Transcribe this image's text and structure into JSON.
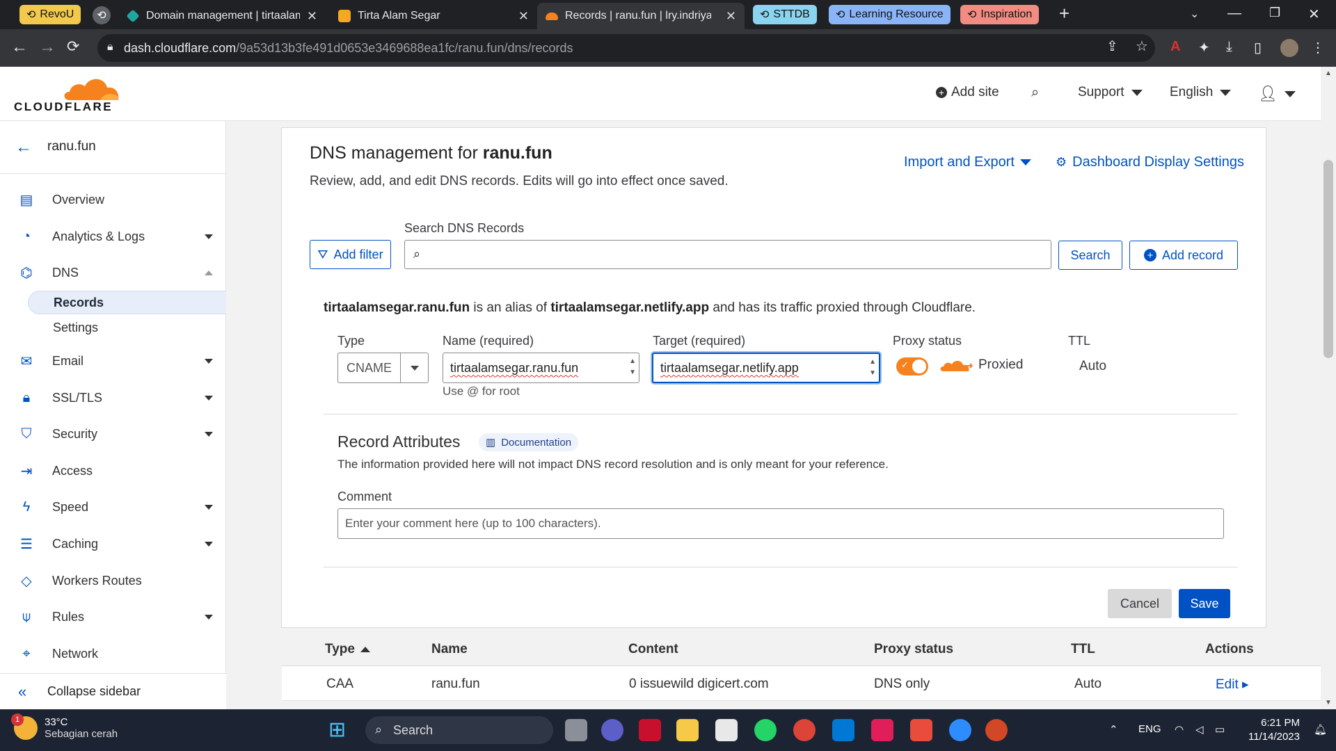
{
  "browser": {
    "tab_groups": [
      {
        "label": "RevoU",
        "color": "#f2c94c"
      },
      {
        "label": "STTDB",
        "color": "#8ad4f0"
      },
      {
        "label": "Learning Resource",
        "color": "#8ab4f8"
      },
      {
        "label": "Inspiration",
        "color": "#f28b82"
      }
    ],
    "tabs": [
      {
        "title": "Domain management | tirtaalam",
        "close": "✕"
      },
      {
        "title": "Tirta Alam Segar",
        "close": "✕"
      },
      {
        "title": "Records | ranu.fun | lry.indriyanto",
        "close": "✕"
      }
    ],
    "new_tab": "+",
    "url_host": "dash.cloudflare.com",
    "url_path": "/9a53d13b3fe491d0653e3469688ea1fc/ranu.fun/dns/records"
  },
  "header": {
    "logo_text": "CLOUDFLARE",
    "add_site": "Add site",
    "support": "Support",
    "language": "English"
  },
  "sidebar": {
    "zone": "ranu.fun",
    "items": [
      {
        "label": "Overview",
        "icon": "clipboard-icon"
      },
      {
        "label": "Analytics & Logs",
        "icon": "pie-chart-icon"
      },
      {
        "label": "DNS",
        "icon": "network-icon"
      },
      {
        "label": "Email",
        "icon": "envelope-icon"
      },
      {
        "label": "SSL/TLS",
        "icon": "lock-icon"
      },
      {
        "label": "Security",
        "icon": "shield-icon"
      },
      {
        "label": "Access",
        "icon": "access-icon"
      },
      {
        "label": "Speed",
        "icon": "bolt-icon"
      },
      {
        "label": "Caching",
        "icon": "server-icon"
      },
      {
        "label": "Workers Routes",
        "icon": "workers-icon"
      },
      {
        "label": "Rules",
        "icon": "rules-icon"
      },
      {
        "label": "Network",
        "icon": "location-icon"
      }
    ],
    "dns_sub": [
      "Records",
      "Settings"
    ],
    "collapse": "Collapse sidebar"
  },
  "main": {
    "title_prefix": "DNS management for",
    "title_zone": "ranu.fun",
    "subtitle": "Review, add, and edit DNS records. Edits will go into effect once saved.",
    "import_export": "Import and Export",
    "dashboard_settings": "Dashboard Display Settings",
    "search_label": "Search DNS Records",
    "add_filter": "Add filter",
    "search_btn": "Search",
    "add_record": "Add record",
    "alias_name": "tirtaalamsegar.ranu.fun",
    "alias_mid": "is an alias of",
    "alias_target": "tirtaalamsegar.netlify.app",
    "alias_end": "and has its traffic proxied through Cloudflare.",
    "form": {
      "type_label": "Type",
      "type_value": "CNAME",
      "name_label": "Name (required)",
      "name_value": "tirtaalamsegar.ranu.fun",
      "name_hint": "Use @ for root",
      "target_label": "Target (required)",
      "target_value": "tirtaalamsegar.netlify.app",
      "proxy_label": "Proxy status",
      "proxy_value": "Proxied",
      "proxy_on": true,
      "ttl_label": "TTL",
      "ttl_value": "Auto"
    },
    "record_attributes": "Record Attributes",
    "documentation": "Documentation",
    "ra_desc": "The information provided here will not impact DNS record resolution and is only meant for your reference.",
    "comment_label": "Comment",
    "comment_placeholder": "Enter your comment here (up to 100 characters).",
    "cancel": "Cancel",
    "save": "Save",
    "table": {
      "headers": [
        "Type",
        "Name",
        "Content",
        "Proxy status",
        "TTL",
        "Actions"
      ],
      "rows": [
        {
          "type": "CAA",
          "name": "ranu.fun",
          "content": "0 issuewild digicert.com",
          "proxy": "DNS only",
          "ttl": "Auto",
          "action": "Edit"
        }
      ]
    }
  },
  "taskbar": {
    "temp": "33°C",
    "weather": "Sebagian cerah",
    "weather_badge": "1",
    "search": "Search",
    "lang": "ENG",
    "time": "6:21 PM",
    "date": "11/14/2023"
  },
  "colors": {
    "accent": "#0051c3",
    "cloudflare_orange": "#f6821f"
  }
}
